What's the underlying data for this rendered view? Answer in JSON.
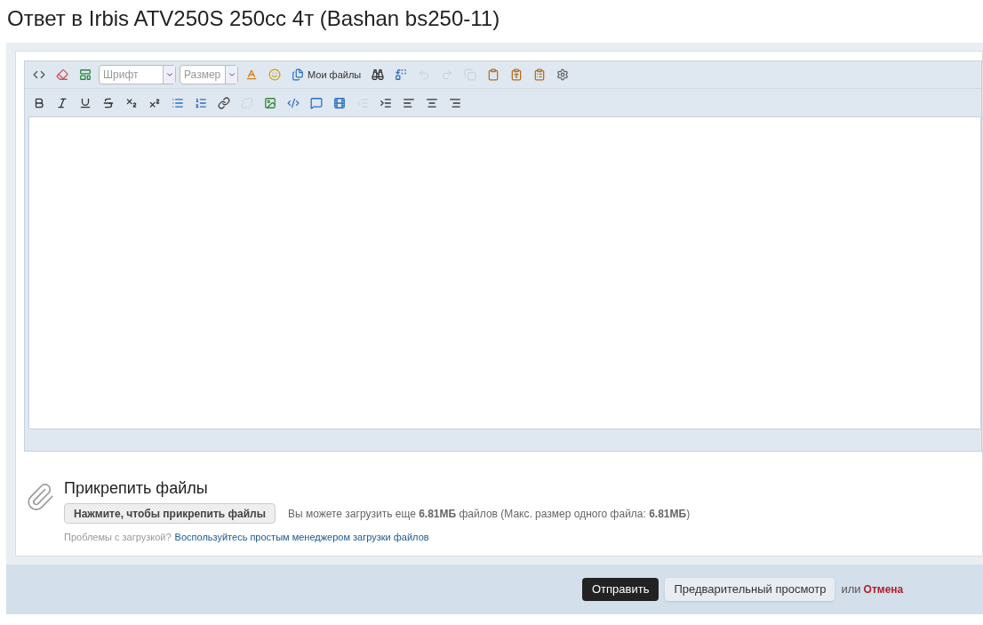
{
  "title": "Ответ в Irbis ATV250S 250cc 4т (Bashan bs250-11)",
  "editor": {
    "font_select": {
      "placeholder": "Шрифт"
    },
    "size_select": {
      "placeholder": "Размер"
    },
    "my_files": "Мои файлы",
    "toolbar_rows": [
      [
        {
          "kind": "source",
          "disabled": false
        },
        {
          "kind": "eraser",
          "disabled": false
        },
        {
          "kind": "template",
          "disabled": false
        },
        {
          "kind": "font"
        },
        {
          "kind": "size"
        },
        {
          "kind": "color",
          "disabled": false
        },
        {
          "kind": "smiley",
          "disabled": false
        },
        {
          "kind": "files",
          "disabled": false
        },
        {
          "kind": "find",
          "disabled": false
        },
        {
          "kind": "replace",
          "disabled": false
        },
        {
          "kind": "undo",
          "disabled": true
        },
        {
          "kind": "redo",
          "disabled": true
        },
        {
          "kind": "copy",
          "disabled": true
        },
        {
          "kind": "paste",
          "disabled": false
        },
        {
          "kind": "paste-text",
          "disabled": false
        },
        {
          "kind": "paste-word",
          "disabled": false
        },
        {
          "kind": "settings",
          "disabled": false
        }
      ],
      [
        {
          "kind": "bold",
          "disabled": false
        },
        {
          "kind": "italic",
          "disabled": false
        },
        {
          "kind": "underline",
          "disabled": false
        },
        {
          "kind": "strike",
          "disabled": false
        },
        {
          "kind": "subscript",
          "disabled": false
        },
        {
          "kind": "superscript",
          "disabled": false
        },
        {
          "kind": "bullets",
          "disabled": false
        },
        {
          "kind": "numbers",
          "disabled": false
        },
        {
          "kind": "link",
          "disabled": false
        },
        {
          "kind": "unlink",
          "disabled": true
        },
        {
          "kind": "image",
          "disabled": false
        },
        {
          "kind": "code",
          "disabled": false
        },
        {
          "kind": "quote",
          "disabled": false
        },
        {
          "kind": "media",
          "disabled": false
        },
        {
          "kind": "outdent",
          "disabled": true
        },
        {
          "kind": "indent",
          "disabled": false
        },
        {
          "kind": "align-left",
          "disabled": false
        },
        {
          "kind": "align-center",
          "disabled": false
        },
        {
          "kind": "align-right",
          "disabled": false
        }
      ]
    ]
  },
  "attach": {
    "heading": "Прикрепить файлы",
    "button": "Нажмите, чтобы прикрепить файлы",
    "info": "Вы можете загрузить еще **6.81МБ** файлов (Макс. размер одного файла: **6.81МБ**)",
    "problem": "Проблемы с загрузкой?",
    "link": "Воспользуйтесь простым менеджером загрузки файлов"
  },
  "footer": {
    "submit": "Отправить",
    "preview": "Предварительный просмотр",
    "or": "или",
    "cancel": "Отмена"
  }
}
